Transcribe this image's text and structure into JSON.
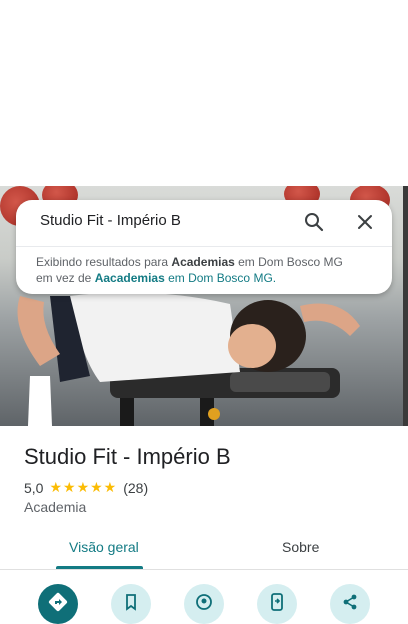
{
  "search": {
    "query": "Studio Fit - Império B"
  },
  "notice": {
    "prefix": "Exibindo resultados para ",
    "shown_term": "Academias",
    "middle": " em Dom Bosco MG",
    "line2_prefix": "em vez de ",
    "original_term": "Aacademias",
    "suffix": " em Dom Bosco MG."
  },
  "place": {
    "name": "Studio Fit - Império B",
    "rating": "5,0",
    "stars": "★★★★★",
    "review_count": "(28)",
    "category": "Academia"
  },
  "tabs": [
    {
      "label": "Visão geral",
      "active": true
    },
    {
      "label": "Sobre",
      "active": false
    }
  ],
  "actions": [
    {
      "icon": "directions-icon"
    },
    {
      "icon": "bookmark-icon"
    },
    {
      "icon": "nearby-icon"
    },
    {
      "icon": "send-to-phone-icon"
    },
    {
      "icon": "share-icon"
    }
  ],
  "colors": {
    "accent": "#137b84",
    "star": "#fbbc04",
    "action_bg": "#d5eef0",
    "primary_action_bg": "#0f6f78"
  }
}
